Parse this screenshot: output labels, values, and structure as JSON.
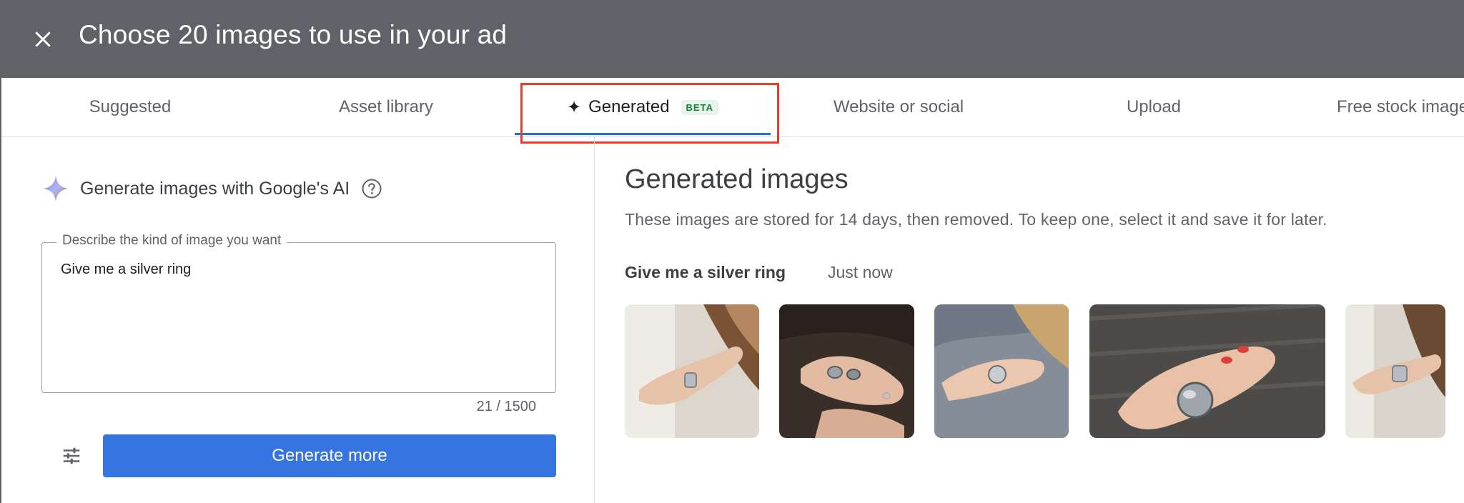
{
  "header": {
    "title": "Choose 20 images to use in your ad"
  },
  "tabs": [
    {
      "label": "Suggested"
    },
    {
      "label": "Asset library"
    },
    {
      "label": "Generated",
      "badge": "BETA",
      "active": true
    },
    {
      "label": "Website or social"
    },
    {
      "label": "Upload"
    },
    {
      "label": "Free stock images"
    }
  ],
  "left": {
    "heading": "Generate images with Google's AI",
    "prompt_label": "Describe the kind of image you want",
    "prompt_value": "Give me a silver ring",
    "char_count": "21 / 1500",
    "generate_label": "Generate more"
  },
  "right": {
    "title": "Generated images",
    "description": "These images are stored for 14 days, then removed. To keep one, select it and save it for later.",
    "batch": {
      "prompt": "Give me a silver ring",
      "time": "Just now"
    }
  },
  "icons": {
    "close": "close-icon",
    "sparkle": "sparkle-icon",
    "help": "help-icon",
    "tune": "tune-icon"
  },
  "colors": {
    "header_bg": "#5f6368",
    "accent": "#1a73e8",
    "button": "#3674e0",
    "highlight": "#e0412e",
    "beta_text": "#188038",
    "beta_bg": "#e6f4ea"
  }
}
